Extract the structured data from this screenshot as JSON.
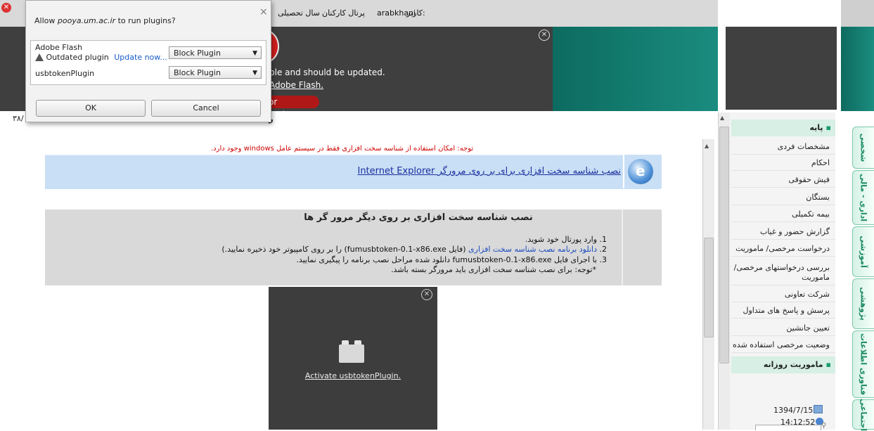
{
  "topbar": {
    "user_label": "کاربر:",
    "user_name": "arabkhani",
    "portal": "پرتال کارکنان",
    "academic_year": "سال تحصیلی"
  },
  "flash_banner": {
    "message": "ble and should be updated.",
    "link": "Adobe Flash.",
    "button": "or updates..."
  },
  "dialog": {
    "title_prefix": "Allow ",
    "title_site": "pooya.um.ac.ir",
    "title_suffix": " to run plugins?",
    "plugins": [
      {
        "name": "Adobe Flash",
        "status": "Outdated plugin",
        "update_link": "Update now...",
        "selected": "Block Plugin"
      },
      {
        "name": "usbtokenPlugin",
        "selected": "Block Plugin"
      }
    ],
    "ok_label": "OK",
    "cancel_label": "Cancel"
  },
  "subrow": {
    "left_text": "۳۸/",
    "mid_text": "راة"
  },
  "content": {
    "note": "توجه: امکان استفاده از شناسه سخت افزاری فقط در سیستم عامل windows وجود دارد.",
    "ie_link": "نصب شناسه سخت افزاری برای بر روی مرورگر Internet Explorer",
    "other_title": "نصب شناسه سخت افزاری بر روی دیگر مرور گر ها",
    "step1": "1. وارد پورتال خود شوید.",
    "step2_pre": "2. ",
    "step2_link": "دانلود برنامه نصب شناسه سخت افزاری",
    "step2_post": " (فایل fumusbtoken-0.1-x86.exe) را بر روی کامپیوتر خود ذخیره نمایید.)",
    "step3": "3. با اجرای فایل fumusbtoken-0.1-x86.exe دانلود شده مراحل نصب برنامه را پیگیری نمایید.",
    "step_note": "*توجه: برای نصب شناسه سخت افزاری باید مرورگر بسته باشد.",
    "activate_plugin": "Activate usbtokenPlugin."
  },
  "sidebar": {
    "section1": "پایه",
    "items": [
      "مشخصات فردی",
      "احکام",
      "فیش حقوقی",
      "بستگان",
      "بیمه تکمیلی",
      "گزارش حضور و غیاب",
      "درخواست مرخصی/ ماموریت",
      "بررسی درخواستهای مرخصی/ماموریت",
      "شرکت تعاونی",
      "پرسش و پاسخ های متداول",
      "تعیین جانشین",
      "وضعیت مرخصی استفاده شده"
    ],
    "section2": "ماموریت روزانه",
    "date": "1394/7/15",
    "time": "14:12:52"
  },
  "vertical_tabs": [
    "شخصی",
    "اداری - مالی",
    "آموزشی",
    "پژوهشی",
    "فناوری اطلاعات",
    "اجتماعی"
  ],
  "colors": {
    "accent_green": "#1b9b6d",
    "ie_row": "#c9dff5",
    "note_red": "#cc0000"
  }
}
